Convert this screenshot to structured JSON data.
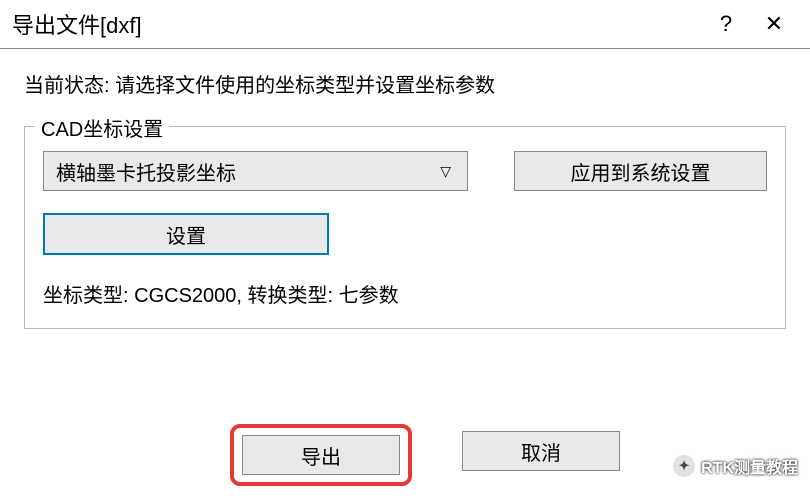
{
  "window": {
    "title": "导出文件[dxf]",
    "help_symbol": "?",
    "close_symbol": "✕"
  },
  "status": {
    "label": "当前状态: ",
    "value": "请选择文件使用的坐标类型并设置坐标参数"
  },
  "cad_settings": {
    "legend": "CAD坐标设置",
    "projection_dropdown": "横轴墨卡托投影坐标",
    "apply_button": "应用到系统设置",
    "settings_button": "设置",
    "coord_type_label": "坐标类型: ",
    "coord_type_value": "CGCS2000",
    "transform_label": ", 转换类型: ",
    "transform_value": "七参数"
  },
  "buttons": {
    "export": "导出",
    "cancel": "取消"
  },
  "watermark": {
    "text": "RTK测量教程"
  }
}
